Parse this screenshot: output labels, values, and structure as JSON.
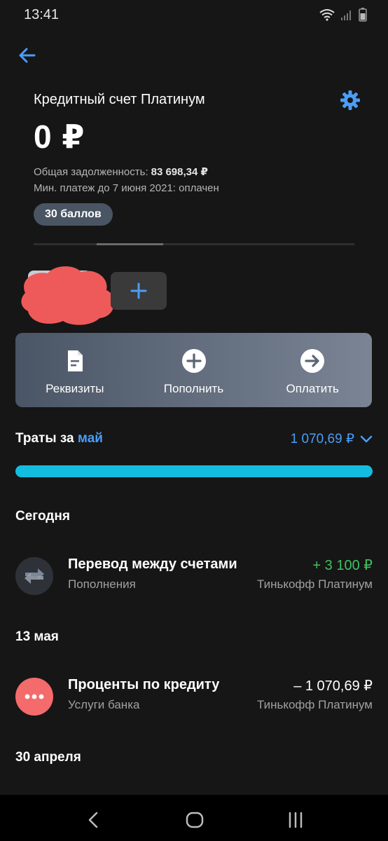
{
  "status": {
    "time": "13:41"
  },
  "account": {
    "title": "Кредитный счет Платинум",
    "balance": "0 ₽",
    "debt_label": "Общая задолженность:",
    "debt_value": "83 698,34 ₽",
    "minpay_text": "Мин. платеж до 7 июня 2021: оплачен",
    "points": "30 баллов"
  },
  "actions": [
    {
      "label": "Реквизиты",
      "icon": "document-icon"
    },
    {
      "label": "Пополнить",
      "icon": "plus-circle-icon"
    },
    {
      "label": "Оплатить",
      "icon": "arrow-right-circle-icon"
    }
  ],
  "spending": {
    "title": "Траты за",
    "month": "май",
    "amount": "1 070,69 ₽",
    "progress": 1.0
  },
  "sections": [
    {
      "date": "Сегодня",
      "transactions": [
        {
          "name": "Перевод между счетами",
          "category": "Пополнения",
          "amount": "+ 3 100 ₽",
          "account": "Тинькофф Платинум",
          "icon": "transfer-icon",
          "amount_color": "#3fc25e"
        }
      ]
    },
    {
      "date": "13 мая",
      "transactions": [
        {
          "name": "Проценты по кредиту",
          "category": "Услуги банка",
          "amount": "– 1 070,69 ₽",
          "account": "Тинькофф Платинум",
          "icon": "dots-icon",
          "amount_color": "#ffffff"
        }
      ]
    },
    {
      "date": "30 апреля",
      "transactions": []
    }
  ],
  "colors": {
    "accent": "#4b9df5",
    "progress": "#13bde0",
    "income": "#3fc25e",
    "bank_service": "#f36b6b"
  }
}
